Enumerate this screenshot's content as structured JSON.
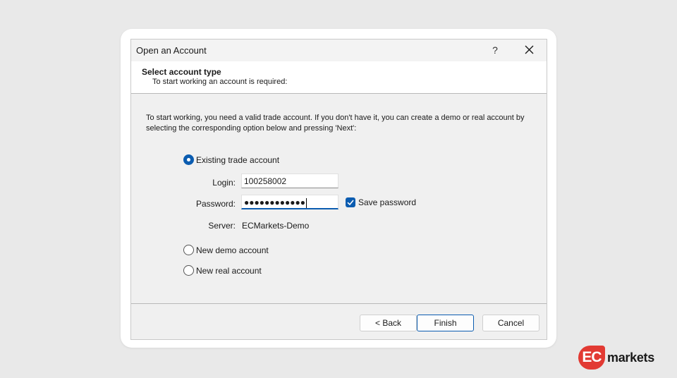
{
  "window": {
    "title": "Open an Account",
    "help_label": "?"
  },
  "header": {
    "title": "Select account type",
    "subtitle": "To start working an account is required:"
  },
  "intro_text": "To start working, you need a valid trade account. If you don't have it, you can create a demo or real account by selecting the corresponding option below and pressing 'Next':",
  "options": {
    "existing": {
      "label": "Existing trade account",
      "selected": true
    },
    "demo": {
      "label": "New demo account",
      "selected": false
    },
    "real": {
      "label": "New real account",
      "selected": false
    }
  },
  "fields": {
    "login_label": "Login:",
    "login_value": "100258002",
    "password_label": "Password:",
    "password_masked": "●●●●●●●●●●●●",
    "save_password_label": "Save password",
    "save_password_checked": true,
    "server_label": "Server:",
    "server_value": "ECMarkets-Demo"
  },
  "buttons": {
    "back": "< Back",
    "finish": "Finish",
    "cancel": "Cancel"
  },
  "brand": {
    "mark": "EC",
    "name": "markets",
    "accent_color": "#e23a33"
  },
  "colors": {
    "accent": "#0b5cb0",
    "dialog_bg": "#f0f0f0",
    "page_bg": "#e9e9e9"
  }
}
